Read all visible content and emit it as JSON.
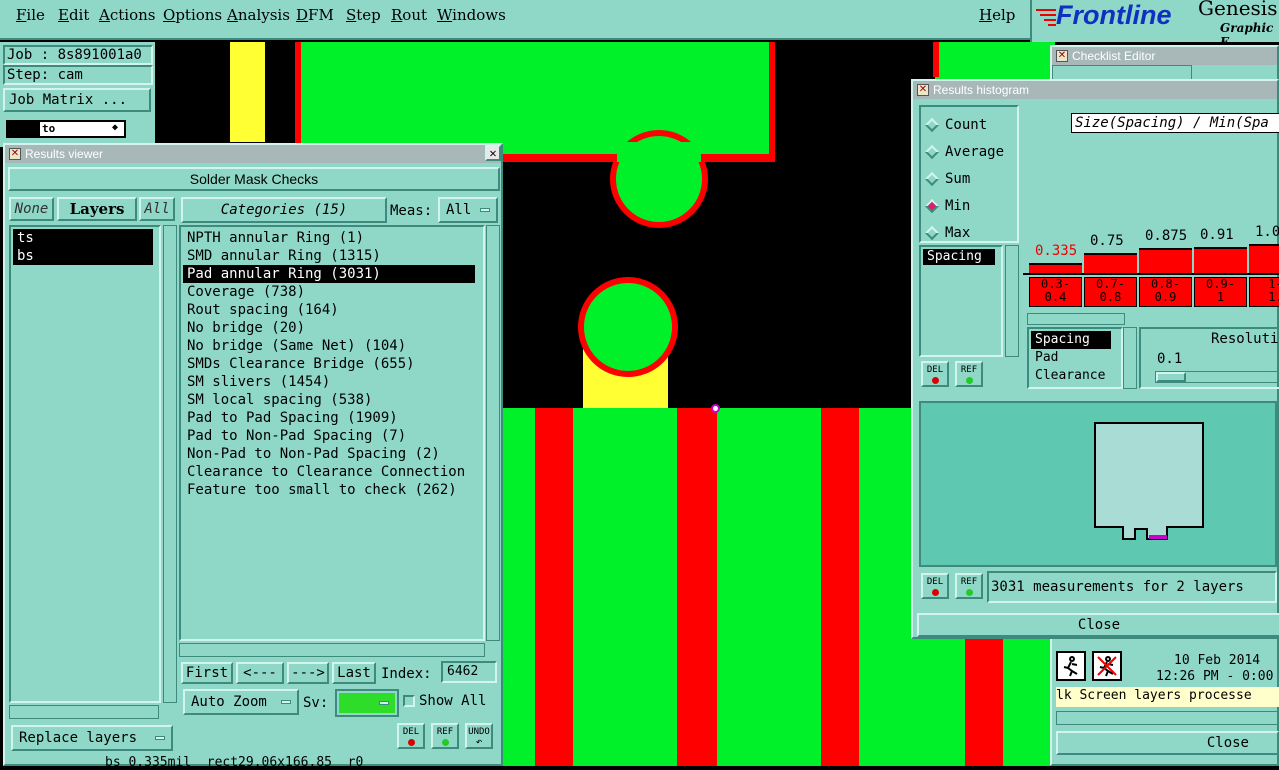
{
  "menubar": {
    "items": [
      "File",
      "Edit",
      "Actions",
      "Options",
      "Analysis",
      "DFM",
      "Step",
      "Rout",
      "Windows"
    ],
    "help": "Help"
  },
  "brand": {
    "name": "Frontline",
    "product": "Genesis",
    "subtitle": "Graphic E"
  },
  "job_panel": {
    "job": "Job : 8s891001a0",
    "step": "Step: cam",
    "job_matrix": "Job Matrix ...",
    "layer_field": "to"
  },
  "results_viewer": {
    "title": "Results viewer",
    "header": "Solder Mask Checks",
    "none_btn": "None",
    "layers_btn": "Layers",
    "all_btn": "All",
    "categories_btn": "Categories (15)",
    "meas_label": "Meas:",
    "meas_value": "All",
    "layers": [
      "ts",
      "bs"
    ],
    "categories": [
      "NPTH annular Ring (1)",
      "SMD annular Ring (1315)",
      "Pad annular Ring (3031)",
      "Coverage (738)",
      "Rout spacing (164)",
      "No bridge (20)",
      "No bridge (Same Net) (104)",
      "SMDs Clearance Bridge (655)",
      "SM slivers (1454)",
      "SM local spacing (538)",
      "Pad to Pad Spacing (1909)",
      "Pad to Non-Pad Spacing (7)",
      "Non-Pad to Non-Pad Spacing (2)",
      "Clearance to Clearance Connection",
      "Feature too small to check (262)"
    ],
    "selected_index": 2,
    "first_btn": "First",
    "prev_btn": "<---",
    "next_btn": "--->",
    "last_btn": "Last",
    "index_label": "Index:",
    "index_value": "6462",
    "auto_zoom": "Auto Zoom",
    "sv_label": "Sv:",
    "show_all": "Show All",
    "replace_layers": "Replace layers",
    "del": "DEL",
    "ref": "REF",
    "undo": "UNDO",
    "status": "bs 0.335mil  rect29.06x166.85  r0"
  },
  "histogram": {
    "title": "Results histogram",
    "modes": [
      "Count",
      "Average",
      "Sum",
      "Min",
      "Max"
    ],
    "selected_mode": "Min",
    "axis_title": "Size(Spacing) / Min(Spa",
    "types": [
      "Spacing"
    ],
    "bins": [
      {
        "label": "0.3-\n0.4",
        "value": "0.335",
        "level": 0.1
      },
      {
        "label": "0.7-\n0.8",
        "value": "0.75",
        "level": 0.2
      },
      {
        "label": "0.8-\n0.9",
        "value": "0.875",
        "level": 0.25
      },
      {
        "label": "0.9-\n1",
        "value": "0.91",
        "level": 0.26
      },
      {
        "label": "1-\n1.",
        "value": "1.0",
        "level": 0.29
      }
    ],
    "attr_list": [
      "Spacing",
      "Pad",
      "Clearance"
    ],
    "resolution_label": "Resoluti",
    "resolution_value": "0.1",
    "measurements": "3031 measurements for 2 layers",
    "close": "Close",
    "del": "DEL",
    "ref": "REF"
  },
  "checklist": {
    "title": "Checklist Editor",
    "date": "10 Feb 2014",
    "time": "12:26 PM - 0:00",
    "message": "lk Screen layers processe",
    "close": "Close"
  },
  "colors": {
    "ui": "#8fd8c8",
    "pcb_green": "#00f02a",
    "pcb_red": "#ff0000",
    "pcb_yellow": "#ffff33"
  }
}
